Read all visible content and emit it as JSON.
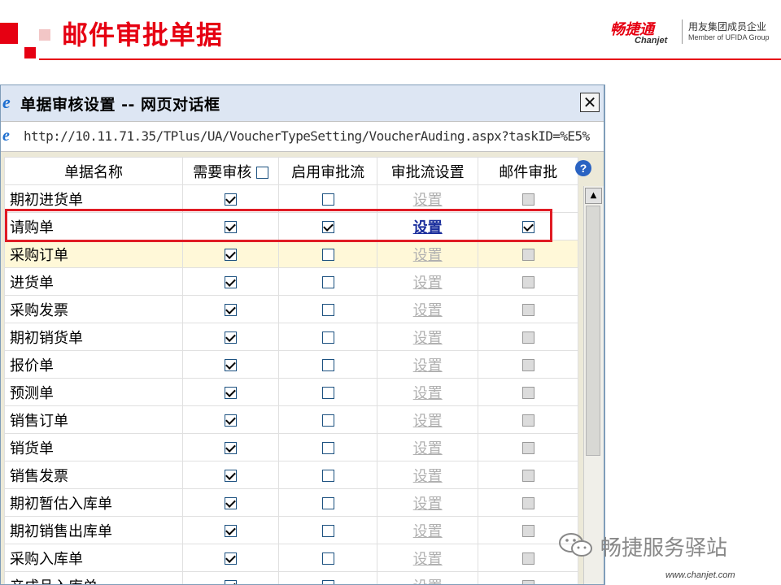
{
  "slide": {
    "title": "邮件审批单据",
    "logo_brand": "畅捷通",
    "logo_brand_en": "Chanjet",
    "logo_corp": "用友集团成员企业",
    "logo_corp_en": "Member of UFIDA Group",
    "accent_color": "#e60012"
  },
  "dialog": {
    "title": "单据审核设置 -- 网页对话框",
    "close_glyph": "✕",
    "url": "http://10.11.71.35/TPlus/UA/VoucherTypeSetting/VoucherAuding.aspx?taskID=%E5%",
    "help_glyph": "?",
    "columns": [
      "单据名称",
      "需要审核",
      "启用审批流",
      "审批流设置",
      "邮件审批"
    ],
    "header_need_audit_checked": false,
    "rows": [
      {
        "name": "期初进货单",
        "need_audit": true,
        "enable_flow": false,
        "setting": "设置",
        "mail": false,
        "highlight": false
      },
      {
        "name": "请购单",
        "need_audit": true,
        "enable_flow": true,
        "setting": "设置",
        "mail": true,
        "highlight": false
      },
      {
        "name": "采购订单",
        "need_audit": true,
        "enable_flow": false,
        "setting": "设置",
        "mail": false,
        "highlight": true
      },
      {
        "name": "进货单",
        "need_audit": true,
        "enable_flow": false,
        "setting": "设置",
        "mail": false,
        "highlight": false
      },
      {
        "name": "采购发票",
        "need_audit": true,
        "enable_flow": false,
        "setting": "设置",
        "mail": false,
        "highlight": false
      },
      {
        "name": "期初销货单",
        "need_audit": true,
        "enable_flow": false,
        "setting": "设置",
        "mail": false,
        "highlight": false
      },
      {
        "name": "报价单",
        "need_audit": true,
        "enable_flow": false,
        "setting": "设置",
        "mail": false,
        "highlight": false
      },
      {
        "name": "预测单",
        "need_audit": true,
        "enable_flow": false,
        "setting": "设置",
        "mail": false,
        "highlight": false
      },
      {
        "name": "销售订单",
        "need_audit": true,
        "enable_flow": false,
        "setting": "设置",
        "mail": false,
        "highlight": false
      },
      {
        "name": "销货单",
        "need_audit": true,
        "enable_flow": false,
        "setting": "设置",
        "mail": false,
        "highlight": false
      },
      {
        "name": "销售发票",
        "need_audit": true,
        "enable_flow": false,
        "setting": "设置",
        "mail": false,
        "highlight": false
      },
      {
        "name": "期初暂估入库单",
        "need_audit": true,
        "enable_flow": false,
        "setting": "设置",
        "mail": false,
        "highlight": false
      },
      {
        "name": "期初销售出库单",
        "need_audit": true,
        "enable_flow": false,
        "setting": "设置",
        "mail": false,
        "highlight": false
      },
      {
        "name": "采购入库单",
        "need_audit": true,
        "enable_flow": false,
        "setting": "设置",
        "mail": false,
        "highlight": false
      },
      {
        "name": "产成品入库单",
        "need_audit": true,
        "enable_flow": false,
        "setting": "设置",
        "mail": false,
        "highlight": false
      }
    ],
    "highlight_box_color": "#e01b24"
  },
  "watermark": {
    "text": "畅捷服务驿站",
    "site": "www.chanjet.com",
    "icon": "wechat-icon"
  }
}
